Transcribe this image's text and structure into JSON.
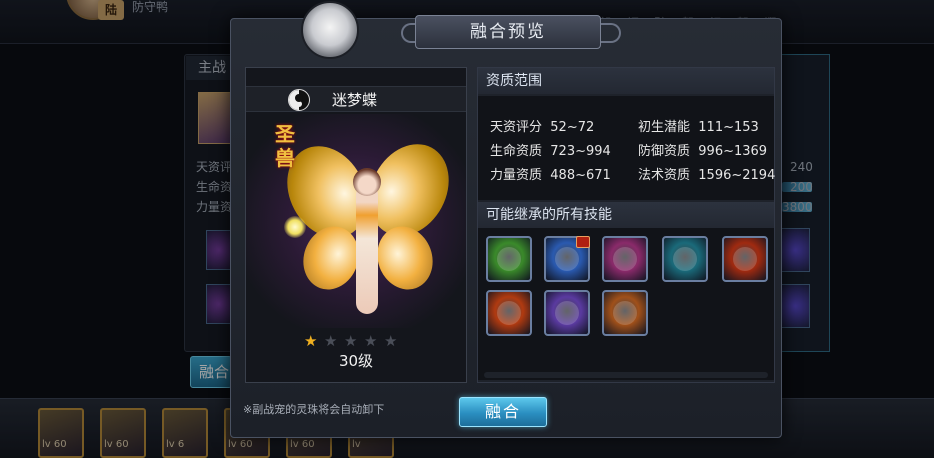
{
  "background": {
    "hero_badge": "陆",
    "hero_name": "防守鸭",
    "top_right_text": "· 怨 · 饲 · 矿 · 驾 · 祝 · 驾 · 诳",
    "tab_label": "主战",
    "stat_labels": [
      "天资评",
      "生命资",
      "力量资"
    ],
    "right_values": [
      "240",
      "200",
      "3800"
    ],
    "fuse_label": "融合",
    "cards": [
      {
        "level": "lv 60"
      },
      {
        "level": "lv 60"
      },
      {
        "level": "lv 6"
      },
      {
        "level": "lv 60"
      },
      {
        "level": "lv 60"
      },
      {
        "level": "lv"
      }
    ]
  },
  "modal": {
    "title": "融合预览",
    "pet": {
      "name": "迷梦蝶",
      "seal_text": "圣兽",
      "stars_filled": 1,
      "stars_total": 5,
      "level": "30级"
    },
    "quality_section": {
      "heading": "资质范围",
      "stats": [
        {
          "label": "天资评分",
          "value": "52~72"
        },
        {
          "label": "初生潜能",
          "value": "111~153"
        },
        {
          "label": "生命资质",
          "value": "723~994"
        },
        {
          "label": "防御资质",
          "value": "996~1369"
        },
        {
          "label": "力量资质",
          "value": "488~671"
        },
        {
          "label": "法术资质",
          "value": "1596~2194"
        }
      ]
    },
    "skills_section": {
      "heading": "可能继承的所有技能",
      "skills": [
        {
          "icon": "green-vortex-skill-icon",
          "color": "#3a8a2a"
        },
        {
          "icon": "blue-swirl-skill-icon",
          "color": "#2a5ab0",
          "badge": true
        },
        {
          "icon": "purple-demon-skill-icon",
          "color": "#8a2a6a"
        },
        {
          "icon": "teal-spirit-skill-icon",
          "color": "#1a6a7a"
        },
        {
          "icon": "red-shield-skill-icon",
          "color": "#a02a10"
        },
        {
          "icon": "fire-beast-skill-icon",
          "color": "#b03a10"
        },
        {
          "icon": "violet-aura-skill-icon",
          "color": "#5a3aa0"
        },
        {
          "icon": "orange-fan-skill-icon",
          "color": "#a0501a"
        }
      ]
    },
    "footer_note": "※副战宠的灵珠将会自动卸下",
    "fuse_button": "融合"
  }
}
